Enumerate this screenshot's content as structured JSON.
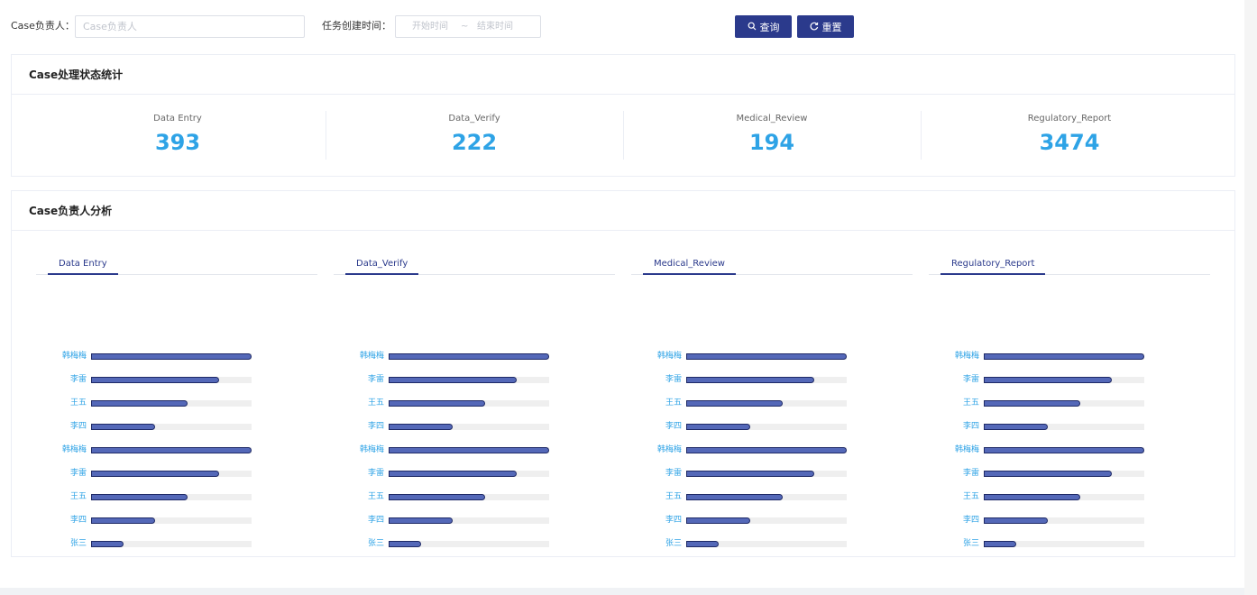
{
  "filters": {
    "owner_label": "Case负责人：",
    "owner_placeholder": "Case负责人",
    "owner_value": "",
    "created_label": "任务创建时间：",
    "start_placeholder": "开始时间",
    "range_separator": "~",
    "end_placeholder": "结束时间",
    "search_icon": "search-icon",
    "search_label": "查询",
    "reset_icon": "refresh-icon",
    "reset_label": "重置"
  },
  "status_card": {
    "title": "Case处理状态统计",
    "stats": [
      {
        "label": "Data Entry",
        "value": "393"
      },
      {
        "label": "Data_Verify",
        "value": "222"
      },
      {
        "label": "Medical_Review",
        "value": "194"
      },
      {
        "label": "Regulatory_Report",
        "value": "3474"
      }
    ]
  },
  "owner_card": {
    "title": "Case负责人分析",
    "panels": [
      {
        "tab": "Data Entry"
      },
      {
        "tab": "Data_Verify"
      },
      {
        "tab": "Medical_Review"
      },
      {
        "tab": "Regulatory_Report"
      }
    ],
    "bars": [
      {
        "name": "韩梅梅",
        "level": 1.0
      },
      {
        "name": "李雷",
        "level": 0.8
      },
      {
        "name": "王五",
        "level": 0.6
      },
      {
        "name": "李四",
        "level": 0.4
      },
      {
        "name": "韩梅梅",
        "level": 1.0
      },
      {
        "name": "李雷",
        "level": 0.8
      },
      {
        "name": "王五",
        "level": 0.6
      },
      {
        "name": "李四",
        "level": 0.4
      },
      {
        "name": "张三",
        "level": 0.2
      }
    ]
  },
  "colors": {
    "primary": "#2b3a8c",
    "accent_blue": "#2ea3e6",
    "bar_fill": "#5468b8",
    "bar_track": "#efefef"
  }
}
